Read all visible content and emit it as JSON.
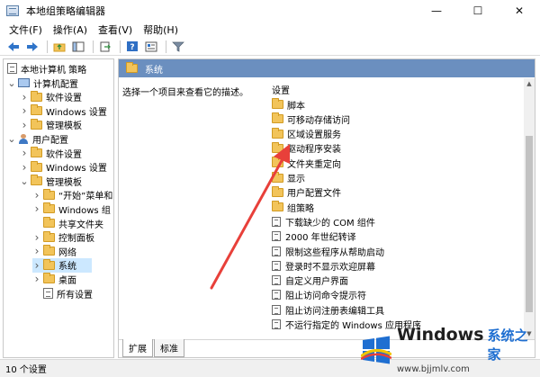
{
  "window": {
    "title": "本地组策略编辑器",
    "controls": {
      "minimize": "—",
      "maximize": "☐",
      "close": "✕"
    }
  },
  "menu": [
    "文件(F)",
    "操作(A)",
    "查看(V)",
    "帮助(H)"
  ],
  "toolbar": {
    "icons": [
      "back-arrow-icon",
      "forward-arrow-icon",
      "up-folder-icon",
      "show-tree-icon",
      "export-icon",
      "help-icon",
      "properties-icon",
      "filter-icon"
    ]
  },
  "tree": {
    "root": "本地计算机 策略",
    "items": [
      {
        "label": "计算机配置",
        "indent": 1,
        "icon": "computer-icon",
        "twisty": "v"
      },
      {
        "label": "软件设置",
        "indent": 2,
        "icon": "folder-icon",
        "twisty": ">"
      },
      {
        "label": "Windows 设置",
        "indent": 2,
        "icon": "folder-icon",
        "twisty": ">"
      },
      {
        "label": "管理模板",
        "indent": 2,
        "icon": "folder-icon",
        "twisty": ">"
      },
      {
        "label": "用户配置",
        "indent": 1,
        "icon": "user-icon",
        "twisty": "v"
      },
      {
        "label": "软件设置",
        "indent": 2,
        "icon": "folder-icon",
        "twisty": ">"
      },
      {
        "label": "Windows 设置",
        "indent": 2,
        "icon": "folder-icon",
        "twisty": ">"
      },
      {
        "label": "管理模板",
        "indent": 2,
        "icon": "folder-icon",
        "twisty": "v"
      },
      {
        "label": "“开始”菜单和",
        "indent": 3,
        "icon": "folder-icon",
        "twisty": ">"
      },
      {
        "label": "Windows 组",
        "indent": 3,
        "icon": "folder-icon",
        "twisty": ">"
      },
      {
        "label": "共享文件夹",
        "indent": 3,
        "icon": "folder-icon",
        "twisty": ""
      },
      {
        "label": "控制面板",
        "indent": 3,
        "icon": "folder-icon",
        "twisty": ">"
      },
      {
        "label": "网络",
        "indent": 3,
        "icon": "folder-icon",
        "twisty": ">"
      },
      {
        "label": "系统",
        "indent": 3,
        "icon": "folder-icon",
        "twisty": ">",
        "selected": true
      },
      {
        "label": "桌面",
        "indent": 3,
        "icon": "folder-icon",
        "twisty": ">"
      },
      {
        "label": "所有设置",
        "indent": 3,
        "icon": "doc-icon",
        "twisty": ""
      }
    ]
  },
  "right_pane": {
    "header": "系统",
    "description": "选择一个项目来查看它的描述。",
    "column_header": "设置",
    "items": [
      {
        "label": "脚本",
        "type": "folder"
      },
      {
        "label": "可移动存储访问",
        "type": "folder"
      },
      {
        "label": "区域设置服务",
        "type": "folder"
      },
      {
        "label": "驱动程序安装",
        "type": "folder"
      },
      {
        "label": "文件夹重定向",
        "type": "folder"
      },
      {
        "label": "显示",
        "type": "folder"
      },
      {
        "label": "用户配置文件",
        "type": "folder"
      },
      {
        "label": "组策略",
        "type": "folder"
      },
      {
        "label": "下载缺少的 COM 组件",
        "type": "policy"
      },
      {
        "label": "2000 年世纪转译",
        "type": "policy"
      },
      {
        "label": "限制这些程序从帮助启动",
        "type": "policy"
      },
      {
        "label": "登录时不显示欢迎屏幕",
        "type": "policy"
      },
      {
        "label": "自定义用户界面",
        "type": "policy"
      },
      {
        "label": "阻止访问命令提示符",
        "type": "policy"
      },
      {
        "label": "阻止访问注册表编辑工具",
        "type": "policy"
      },
      {
        "label": "不运行指定的 Windows 应用程序",
        "type": "policy"
      }
    ],
    "tabs": [
      "扩展",
      "标准"
    ],
    "active_tab": 0
  },
  "status": "10 个设置",
  "watermark": {
    "brand": "Windows",
    "sub": "系统之家",
    "url": "www.bjjmlv.com"
  },
  "colors": {
    "header_bg": "#6b8fbf",
    "selection": "#cce8ff",
    "arrow": "#e8403a",
    "folder": "#f2c45a"
  }
}
